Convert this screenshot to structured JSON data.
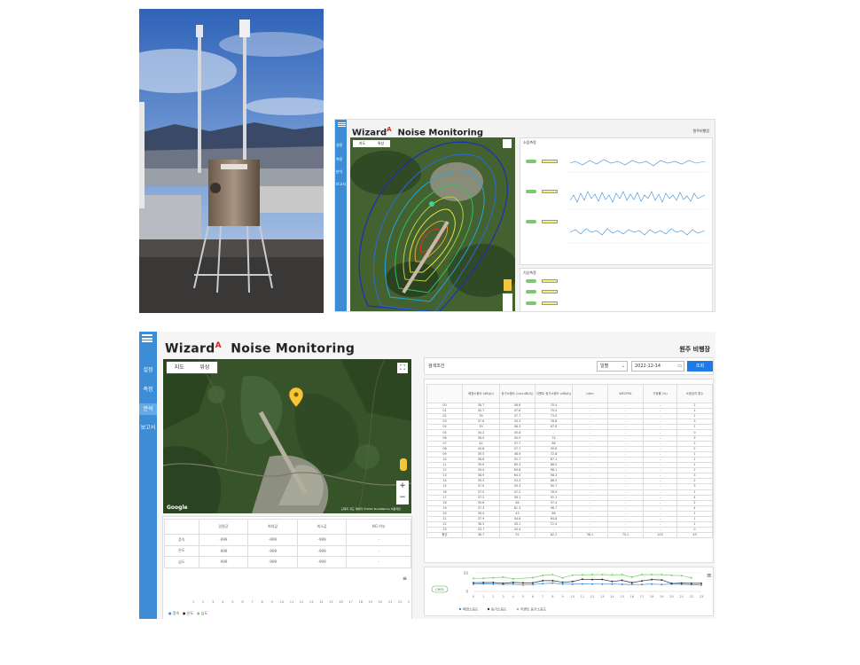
{
  "photo": {
    "description_icon": "monitoring-station-photo"
  },
  "small": {
    "app_title": "Wizard",
    "app_title_sup": "A",
    "app_title_rest": "Noise Monitoring",
    "site": "원주비행장",
    "nav": [
      "설정",
      "측정",
      "분석",
      "보고서"
    ],
    "map_tabs": [
      "지도",
      "위성"
    ],
    "panel1_title": "소음측정",
    "panel2_title": "기상측정"
  },
  "big": {
    "app_title": "Wizard",
    "app_title_sup": "A",
    "app_title_rest": "Noise Monitoring",
    "site": "원주 비행장",
    "nav": [
      "설정",
      "측정",
      "분석",
      "보고서"
    ],
    "active_nav": 2,
    "map_tabs": [
      "지도",
      "위성"
    ],
    "map_google": "Google",
    "map_copyright": "단축키  지도 데이터 ©2022 TerraMetrics  이용약관",
    "env_table": {
      "headers": [
        "",
        "일평균",
        "최대값",
        "최소값",
        "NG 여부"
      ],
      "rows": [
        [
          "풍속",
          "-999",
          "-999",
          "-999",
          "-"
        ],
        [
          "온도",
          "-999",
          "-999",
          "-999",
          "-"
        ],
        [
          "습도",
          "-999",
          "-999",
          "-999",
          "-"
        ]
      ]
    },
    "env_chart": {
      "x_labels": [
        "1",
        "2",
        "3",
        "4",
        "5",
        "6",
        "7",
        "8",
        "9",
        "10",
        "11",
        "12",
        "13",
        "14",
        "15",
        "16",
        "17",
        "18",
        "19",
        "20",
        "21",
        "22",
        "23"
      ],
      "legend": [
        "풍속",
        "온도",
        "습도"
      ],
      "colors": [
        "#3c8dd6",
        "#333333",
        "#7bd16b"
      ]
    },
    "search": {
      "label": "검색조건",
      "select_value": "일별",
      "date_value": "2022-12-14",
      "button": "조회"
    },
    "hourly_table": {
      "headers": [
        "",
        "배경소음도 (dB(A))",
        "등가소음도 (Leq dB(A))",
        "이벤트 등가소음도 (dB(A))",
        "Lden",
        "WECPNL",
        "가동률 (%)",
        "소음검지 횟수"
      ],
      "rows": [
        [
          "00",
          "38.7",
          "46.6",
          "70.4",
          "-",
          "-",
          "-",
          "2"
        ],
        [
          "01",
          "40.7",
          "47.6",
          "70.4",
          "-",
          "-",
          "-",
          "1"
        ],
        [
          "02",
          "39",
          "47.7",
          "73.5",
          "-",
          "-",
          "-",
          "1"
        ],
        [
          "03",
          "37.6",
          "43.3",
          "76.8",
          "-",
          "-",
          "-",
          "3"
        ],
        [
          "04",
          "39",
          "48.3",
          "67.8",
          "-",
          "-",
          "-",
          "1"
        ],
        [
          "05",
          "34.2",
          "45.8",
          "-",
          "-",
          "-",
          "-",
          "0"
        ],
        [
          "06",
          "36.9",
          "45.9",
          "74",
          "-",
          "-",
          "-",
          "3"
        ],
        [
          "07",
          "42",
          "57.7",
          "86",
          "-",
          "-",
          "-",
          "2"
        ],
        [
          "08",
          "44.8",
          "57.7",
          "95.8",
          "-",
          "-",
          "-",
          "2"
        ],
        [
          "09",
          "39.5",
          "48.9",
          "72.8",
          "-",
          "-",
          "-",
          "1"
        ],
        [
          "10",
          "38.6",
          "52.7",
          "87.1",
          "-",
          "-",
          "-",
          "1"
        ],
        [
          "11",
          "39.9",
          "65.3",
          "88.5",
          "-",
          "-",
          "-",
          "1"
        ],
        [
          "12",
          "39.4",
          "63.8",
          "98.1",
          "-",
          "-",
          "-",
          "2"
        ],
        [
          "13",
          "38.9",
          "64.3",
          "98.3",
          "-",
          "-",
          "-",
          "3"
        ],
        [
          "14",
          "39.3",
          "53.3",
          "88.5",
          "-",
          "-",
          "-",
          "2"
        ],
        [
          "15",
          "37.9",
          "59.3",
          "90.7",
          "-",
          "-",
          "-",
          "3"
        ],
        [
          "16",
          "37.5",
          "47.2",
          "76.9",
          "-",
          "-",
          "-",
          "1"
        ],
        [
          "17",
          "37.2",
          "56.1",
          "91.1",
          "-",
          "-",
          "-",
          "4"
        ],
        [
          "18",
          "39.6",
          "64",
          "97.4",
          "-",
          "-",
          "-",
          "2"
        ],
        [
          "19",
          "37.3",
          "61.3",
          "96.7",
          "-",
          "-",
          "-",
          "4"
        ],
        [
          "20",
          "39.4",
          "43",
          "86",
          "-",
          "-",
          "-",
          "1"
        ],
        [
          "21",
          "37.9",
          "44.8",
          "84.8",
          "-",
          "-",
          "-",
          "1"
        ],
        [
          "22",
          "36.3",
          "43.1",
          "72.4",
          "-",
          "-",
          "-",
          "1"
        ],
        [
          "23",
          "33.7",
          "43.4",
          "-",
          "-",
          "-",
          "-",
          "0"
        ],
        [
          "평균",
          "38.7",
          "52",
          "82.2",
          "58.1",
          "75.2",
          "100",
          "49"
        ]
      ]
    },
    "noise_chart": {
      "badge": "CH01",
      "y_top": "50",
      "y_zero": "0",
      "x_labels": [
        "0",
        "1",
        "2",
        "3",
        "4",
        "5",
        "6",
        "7",
        "8",
        "9",
        "10",
        "11",
        "12",
        "13",
        "14",
        "15",
        "16",
        "17",
        "18",
        "19",
        "20",
        "21",
        "22",
        "23"
      ],
      "legend": [
        "배경소음도",
        "등가소음도",
        "이벤트 등가소음도"
      ],
      "colors": [
        "#3c8dd6",
        "#333333",
        "#7bd16b"
      ]
    }
  },
  "chart_data": {
    "type": "line",
    "categories": [
      "0",
      "1",
      "2",
      "3",
      "4",
      "5",
      "6",
      "7",
      "8",
      "9",
      "10",
      "11",
      "12",
      "13",
      "14",
      "15",
      "16",
      "17",
      "18",
      "19",
      "20",
      "21",
      "22",
      "23"
    ],
    "ylim": [
      0,
      50
    ],
    "series": [
      {
        "name": "배경소음도",
        "values": [
          38.7,
          40.7,
          39,
          37.6,
          39,
          34.2,
          36.9,
          42,
          44.8,
          39.5,
          38.6,
          39.9,
          39.4,
          38.9,
          39.3,
          37.9,
          37.5,
          37.2,
          39.6,
          37.3,
          39.4,
          37.9,
          36.3,
          33.7
        ]
      },
      {
        "name": "등가소음도",
        "values": [
          46.6,
          47.6,
          47.7,
          43.3,
          48.3,
          45.8,
          45.9,
          57.7,
          57.7,
          48.9,
          52.7,
          65.3,
          63.8,
          64.3,
          53.3,
          59.3,
          47.2,
          56.1,
          64,
          61.3,
          43,
          44.8,
          43.1,
          43.4
        ]
      },
      {
        "name": "이벤트 등가소음도",
        "values": [
          70.4,
          70.4,
          73.5,
          76.8,
          67.8,
          null,
          74,
          86,
          95.8,
          72.8,
          87.1,
          88.5,
          98.1,
          98.3,
          88.5,
          90.7,
          76.9,
          91.1,
          97.4,
          96.7,
          86,
          84.8,
          72.4,
          null
        ]
      }
    ]
  }
}
